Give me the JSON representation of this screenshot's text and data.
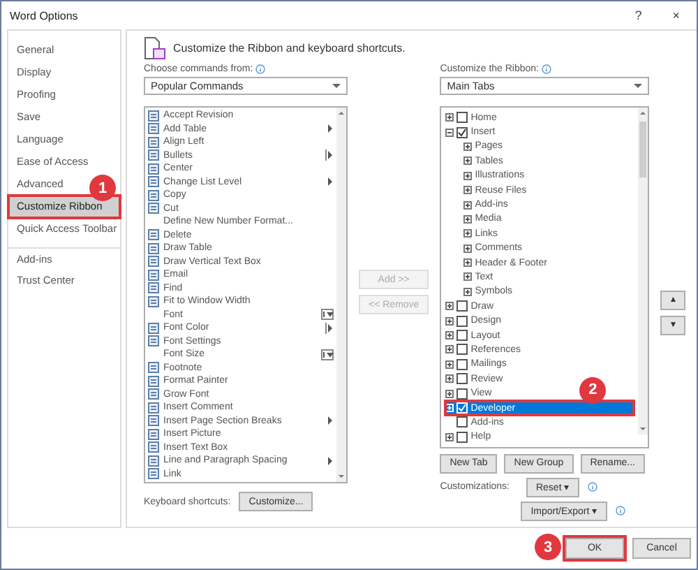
{
  "window": {
    "title": "Word Options",
    "help": "?",
    "close": "×"
  },
  "sidebar": {
    "items": [
      {
        "label": "General",
        "selected": false
      },
      {
        "label": "Display",
        "selected": false
      },
      {
        "label": "Proofing",
        "selected": false
      },
      {
        "label": "Save",
        "selected": false
      },
      {
        "label": "Language",
        "selected": false
      },
      {
        "label": "Ease of Access",
        "selected": false
      },
      {
        "label": "Advanced",
        "selected": false
      },
      {
        "label": "Customize Ribbon",
        "selected": true,
        "callout": "1"
      },
      {
        "label": "Quick Access Toolbar",
        "selected": false
      },
      {
        "label": "Add-ins",
        "selected": false,
        "group_start": true
      },
      {
        "label": "Trust Center",
        "selected": false
      }
    ]
  },
  "heading": "Customize the Ribbon and keyboard shortcuts.",
  "commands": {
    "label": "Choose commands from:",
    "dropdown": "Popular Commands",
    "items": [
      {
        "label": "Accept Revision",
        "icon": true
      },
      {
        "label": "Add Table",
        "icon": true,
        "submenu": true
      },
      {
        "label": "Align Left",
        "icon": true
      },
      {
        "label": "Bullets",
        "icon": true,
        "split": true
      },
      {
        "label": "Center",
        "icon": true
      },
      {
        "label": "Change List Level",
        "icon": true,
        "submenu": true
      },
      {
        "label": "Copy",
        "icon": true
      },
      {
        "label": "Cut",
        "icon": true
      },
      {
        "label": "Define New Number Format...",
        "icon": false
      },
      {
        "label": "Delete",
        "icon": true
      },
      {
        "label": "Draw Table",
        "icon": true
      },
      {
        "label": "Draw Vertical Text Box",
        "icon": true
      },
      {
        "label": "Email",
        "icon": true
      },
      {
        "label": "Find",
        "icon": true
      },
      {
        "label": "Fit to Window Width",
        "icon": true
      },
      {
        "label": "Font",
        "icon": false,
        "combo": true
      },
      {
        "label": "Font Color",
        "icon": true,
        "split": true
      },
      {
        "label": "Font Settings",
        "icon": true
      },
      {
        "label": "Font Size",
        "icon": false,
        "combo": true
      },
      {
        "label": "Footnote",
        "icon": true
      },
      {
        "label": "Format Painter",
        "icon": true
      },
      {
        "label": "Grow Font",
        "icon": true
      },
      {
        "label": "Insert Comment",
        "icon": true
      },
      {
        "label": "Insert Page  Section Breaks",
        "icon": true,
        "submenu": true
      },
      {
        "label": "Insert Picture",
        "icon": true
      },
      {
        "label": "Insert Text Box",
        "icon": true
      },
      {
        "label": "Line and Paragraph Spacing",
        "icon": true,
        "submenu": true
      },
      {
        "label": "Link",
        "icon": true
      }
    ]
  },
  "shortcuts": {
    "label": "Keyboard shortcuts:",
    "button": "Customize..."
  },
  "move_buttons": [
    {
      "label": "Add >>",
      "disabled": true
    },
    {
      "label": "<< Remove",
      "disabled": true
    }
  ],
  "ribbon": {
    "label": "Customize the Ribbon:",
    "dropdown": "Main Tabs",
    "tree": [
      {
        "label": "Home",
        "expanded": false,
        "checked": false,
        "selected": false
      },
      {
        "label": "Insert",
        "expanded": true,
        "checked": true,
        "selected": false,
        "children": [
          {
            "label": "Pages",
            "expanded": false
          },
          {
            "label": "Tables",
            "expanded": false
          },
          {
            "label": "Illustrations",
            "expanded": false
          },
          {
            "label": "Reuse Files",
            "expanded": false
          },
          {
            "label": "Add-ins",
            "expanded": false
          },
          {
            "label": "Media",
            "expanded": false
          },
          {
            "label": "Links",
            "expanded": false
          },
          {
            "label": "Comments",
            "expanded": false
          },
          {
            "label": "Header & Footer",
            "expanded": false
          },
          {
            "label": "Text",
            "expanded": false
          },
          {
            "label": "Symbols",
            "expanded": false
          }
        ]
      },
      {
        "label": "Draw",
        "expanded": false,
        "checked": false,
        "selected": false
      },
      {
        "label": "Design",
        "expanded": false,
        "checked": false,
        "selected": false
      },
      {
        "label": "Layout",
        "expanded": false,
        "checked": false,
        "selected": false
      },
      {
        "label": "References",
        "expanded": false,
        "checked": false,
        "selected": false
      },
      {
        "label": "Mailings",
        "expanded": false,
        "checked": false,
        "selected": false
      },
      {
        "label": "Review",
        "expanded": false,
        "checked": false,
        "selected": false
      },
      {
        "label": "View",
        "expanded": false,
        "checked": false,
        "selected": false
      },
      {
        "label": "Developer",
        "expanded": false,
        "checked": true,
        "selected": true,
        "callout": "2"
      },
      {
        "label": "Add-ins",
        "checked": false,
        "selected": false
      },
      {
        "label": "Help",
        "expanded": false,
        "checked": false,
        "selected": false
      }
    ]
  },
  "order_buttons": [
    "▲",
    "▼"
  ],
  "tab_buttons": [
    "New Tab",
    "New Group",
    "Rename..."
  ],
  "customizations": {
    "label": "Customizations:",
    "reset": "Reset ▾",
    "import_export": "Import/Export ▾"
  },
  "footer": [
    {
      "label": "OK",
      "callout": "3"
    },
    {
      "label": "Cancel"
    }
  ]
}
